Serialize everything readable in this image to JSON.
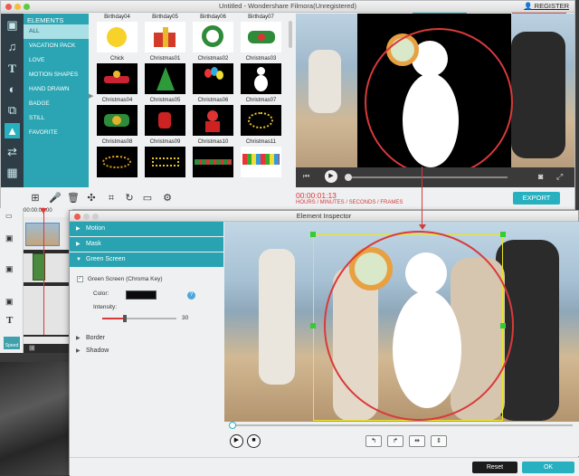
{
  "window": {
    "title": "Untitled - Wondershare Filmora(Unregistered)",
    "register_label": "REGISTER"
  },
  "sidebar_icons": [
    "media-icon",
    "music-icon",
    "text-icon",
    "filter-icon",
    "overlay-icon",
    "elements-icon",
    "transition-icon",
    "split-screen-icon"
  ],
  "elements_panel": {
    "title": "ELEMENTS",
    "categories": [
      "ALL",
      "VACATION PACK",
      "LOVE",
      "MOTION SHAPES",
      "HAND DRAWN",
      "BADGE",
      "STILL",
      "FAVORITE"
    ],
    "selected": "ALL"
  },
  "thumbnails": [
    {
      "label": "Birthday04"
    },
    {
      "label": "Birthday05"
    },
    {
      "label": "Birthday06"
    },
    {
      "label": "Birthday07"
    },
    {
      "label": "Chick"
    },
    {
      "label": "Christmas01"
    },
    {
      "label": "Christmas02"
    },
    {
      "label": "Christmas03"
    },
    {
      "label": "Christmas04"
    },
    {
      "label": "Christmas05"
    },
    {
      "label": "Christmas06"
    },
    {
      "label": "Christmas07"
    },
    {
      "label": "Christmas08"
    },
    {
      "label": "Christmas09"
    },
    {
      "label": "Christmas10"
    },
    {
      "label": "Christmas11"
    }
  ],
  "player": {
    "timecode": "00:00:01:13",
    "time_units": "HOURS / MINUTES / SECONDS / FRAMES",
    "export_label": "EXPORT"
  },
  "timeline": {
    "ruler_start": "00:00:00:00",
    "speed_label": "Speed"
  },
  "inspector": {
    "title": "Element Inspector",
    "sections": {
      "motion": "Motion",
      "mask": "Mask",
      "green_screen": "Green Screen",
      "border": "Border",
      "shadow": "Shadow"
    },
    "green_screen_checkbox": "Green Screen (Chroma Key)",
    "green_screen_checked": true,
    "color_label": "Color:",
    "color_value": "#0b0b0b",
    "intensity_label": "Intensity:",
    "intensity_value": "30",
    "reset_label": "Reset",
    "ok_label": "OK"
  },
  "colors": {
    "accent": "#27b1c0",
    "sidebar_dark": "#2f3e46",
    "timecode_red": "#d93a3a"
  }
}
